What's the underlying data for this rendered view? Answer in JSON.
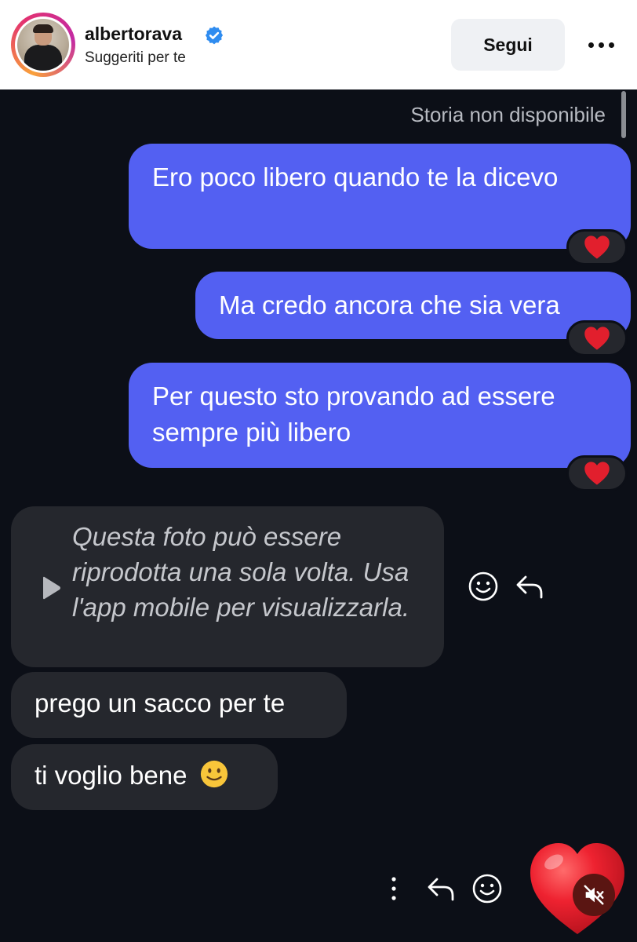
{
  "header": {
    "username": "albertorava",
    "subtitle": "Suggeriti per te",
    "follow_label": "Segui",
    "verified_icon": "verified-badge-icon",
    "more_icon": "more-horizontal-icon"
  },
  "chat": {
    "story_note": "Storia non disponibile",
    "messages_out": [
      {
        "text": "Ero poco libero quando te la dicevo",
        "reaction": "❤️"
      },
      {
        "text": "Ma credo ancora che sia vera",
        "reaction": "❤️"
      },
      {
        "text": "Per questo sto provando ad essere sempre più libero",
        "reaction": "❤️"
      }
    ],
    "photo_message": {
      "text": "Questa foto può essere riprodotta una sola volta. Usa l'app mobile per visualizzarla.",
      "icon": "play-icon"
    },
    "messages_in": [
      {
        "text": "prego un sacco per te"
      },
      {
        "text": "ti voglio bene",
        "emoji": "🙂"
      }
    ],
    "actions": [
      "emoji-react-icon",
      "reply-icon",
      "more-vertical-icon"
    ]
  },
  "footer": {
    "like_icon": "heart-icon",
    "mute_icon": "muted-speaker-icon"
  },
  "colors": {
    "outgoing_bubble": "#5360f2",
    "incoming_bubble": "#25272d",
    "background": "#0c0f17",
    "verified": "#2f8cf0",
    "heart": "#e21f2d"
  }
}
